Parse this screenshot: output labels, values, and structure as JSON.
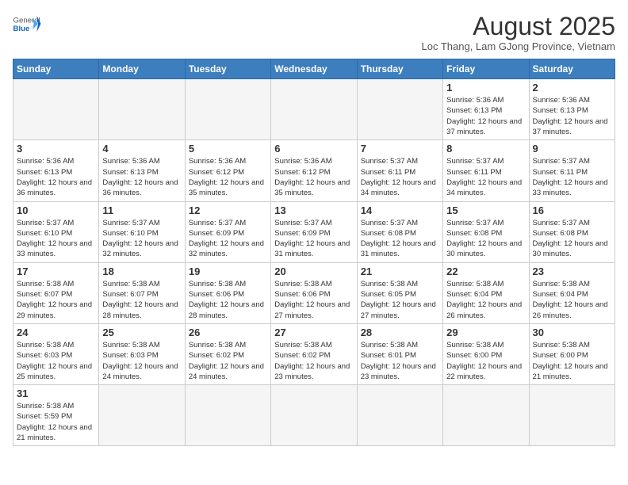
{
  "logo": {
    "general": "General",
    "blue": "Blue"
  },
  "title": "August 2025",
  "subtitle": "Loc Thang, Lam GJong Province, Vietnam",
  "weekdays": [
    "Sunday",
    "Monday",
    "Tuesday",
    "Wednesday",
    "Thursday",
    "Friday",
    "Saturday"
  ],
  "weeks": [
    [
      {
        "day": "",
        "info": ""
      },
      {
        "day": "",
        "info": ""
      },
      {
        "day": "",
        "info": ""
      },
      {
        "day": "",
        "info": ""
      },
      {
        "day": "",
        "info": ""
      },
      {
        "day": "1",
        "info": "Sunrise: 5:36 AM\nSunset: 6:13 PM\nDaylight: 12 hours\nand 37 minutes."
      },
      {
        "day": "2",
        "info": "Sunrise: 5:36 AM\nSunset: 6:13 PM\nDaylight: 12 hours\nand 37 minutes."
      }
    ],
    [
      {
        "day": "3",
        "info": "Sunrise: 5:36 AM\nSunset: 6:13 PM\nDaylight: 12 hours\nand 36 minutes."
      },
      {
        "day": "4",
        "info": "Sunrise: 5:36 AM\nSunset: 6:13 PM\nDaylight: 12 hours\nand 36 minutes."
      },
      {
        "day": "5",
        "info": "Sunrise: 5:36 AM\nSunset: 6:12 PM\nDaylight: 12 hours\nand 35 minutes."
      },
      {
        "day": "6",
        "info": "Sunrise: 5:36 AM\nSunset: 6:12 PM\nDaylight: 12 hours\nand 35 minutes."
      },
      {
        "day": "7",
        "info": "Sunrise: 5:37 AM\nSunset: 6:11 PM\nDaylight: 12 hours\nand 34 minutes."
      },
      {
        "day": "8",
        "info": "Sunrise: 5:37 AM\nSunset: 6:11 PM\nDaylight: 12 hours\nand 34 minutes."
      },
      {
        "day": "9",
        "info": "Sunrise: 5:37 AM\nSunset: 6:11 PM\nDaylight: 12 hours\nand 33 minutes."
      }
    ],
    [
      {
        "day": "10",
        "info": "Sunrise: 5:37 AM\nSunset: 6:10 PM\nDaylight: 12 hours\nand 33 minutes."
      },
      {
        "day": "11",
        "info": "Sunrise: 5:37 AM\nSunset: 6:10 PM\nDaylight: 12 hours\nand 32 minutes."
      },
      {
        "day": "12",
        "info": "Sunrise: 5:37 AM\nSunset: 6:09 PM\nDaylight: 12 hours\nand 32 minutes."
      },
      {
        "day": "13",
        "info": "Sunrise: 5:37 AM\nSunset: 6:09 PM\nDaylight: 12 hours\nand 31 minutes."
      },
      {
        "day": "14",
        "info": "Sunrise: 5:37 AM\nSunset: 6:08 PM\nDaylight: 12 hours\nand 31 minutes."
      },
      {
        "day": "15",
        "info": "Sunrise: 5:37 AM\nSunset: 6:08 PM\nDaylight: 12 hours\nand 30 minutes."
      },
      {
        "day": "16",
        "info": "Sunrise: 5:37 AM\nSunset: 6:08 PM\nDaylight: 12 hours\nand 30 minutes."
      }
    ],
    [
      {
        "day": "17",
        "info": "Sunrise: 5:38 AM\nSunset: 6:07 PM\nDaylight: 12 hours\nand 29 minutes."
      },
      {
        "day": "18",
        "info": "Sunrise: 5:38 AM\nSunset: 6:07 PM\nDaylight: 12 hours\nand 28 minutes."
      },
      {
        "day": "19",
        "info": "Sunrise: 5:38 AM\nSunset: 6:06 PM\nDaylight: 12 hours\nand 28 minutes."
      },
      {
        "day": "20",
        "info": "Sunrise: 5:38 AM\nSunset: 6:06 PM\nDaylight: 12 hours\nand 27 minutes."
      },
      {
        "day": "21",
        "info": "Sunrise: 5:38 AM\nSunset: 6:05 PM\nDaylight: 12 hours\nand 27 minutes."
      },
      {
        "day": "22",
        "info": "Sunrise: 5:38 AM\nSunset: 6:04 PM\nDaylight: 12 hours\nand 26 minutes."
      },
      {
        "day": "23",
        "info": "Sunrise: 5:38 AM\nSunset: 6:04 PM\nDaylight: 12 hours\nand 26 minutes."
      }
    ],
    [
      {
        "day": "24",
        "info": "Sunrise: 5:38 AM\nSunset: 6:03 PM\nDaylight: 12 hours\nand 25 minutes."
      },
      {
        "day": "25",
        "info": "Sunrise: 5:38 AM\nSunset: 6:03 PM\nDaylight: 12 hours\nand 24 minutes."
      },
      {
        "day": "26",
        "info": "Sunrise: 5:38 AM\nSunset: 6:02 PM\nDaylight: 12 hours\nand 24 minutes."
      },
      {
        "day": "27",
        "info": "Sunrise: 5:38 AM\nSunset: 6:02 PM\nDaylight: 12 hours\nand 23 minutes."
      },
      {
        "day": "28",
        "info": "Sunrise: 5:38 AM\nSunset: 6:01 PM\nDaylight: 12 hours\nand 23 minutes."
      },
      {
        "day": "29",
        "info": "Sunrise: 5:38 AM\nSunset: 6:00 PM\nDaylight: 12 hours\nand 22 minutes."
      },
      {
        "day": "30",
        "info": "Sunrise: 5:38 AM\nSunset: 6:00 PM\nDaylight: 12 hours\nand 21 minutes."
      }
    ],
    [
      {
        "day": "31",
        "info": "Sunrise: 5:38 AM\nSunset: 5:59 PM\nDaylight: 12 hours\nand 21 minutes."
      },
      {
        "day": "",
        "info": ""
      },
      {
        "day": "",
        "info": ""
      },
      {
        "day": "",
        "info": ""
      },
      {
        "day": "",
        "info": ""
      },
      {
        "day": "",
        "info": ""
      },
      {
        "day": "",
        "info": ""
      }
    ]
  ]
}
